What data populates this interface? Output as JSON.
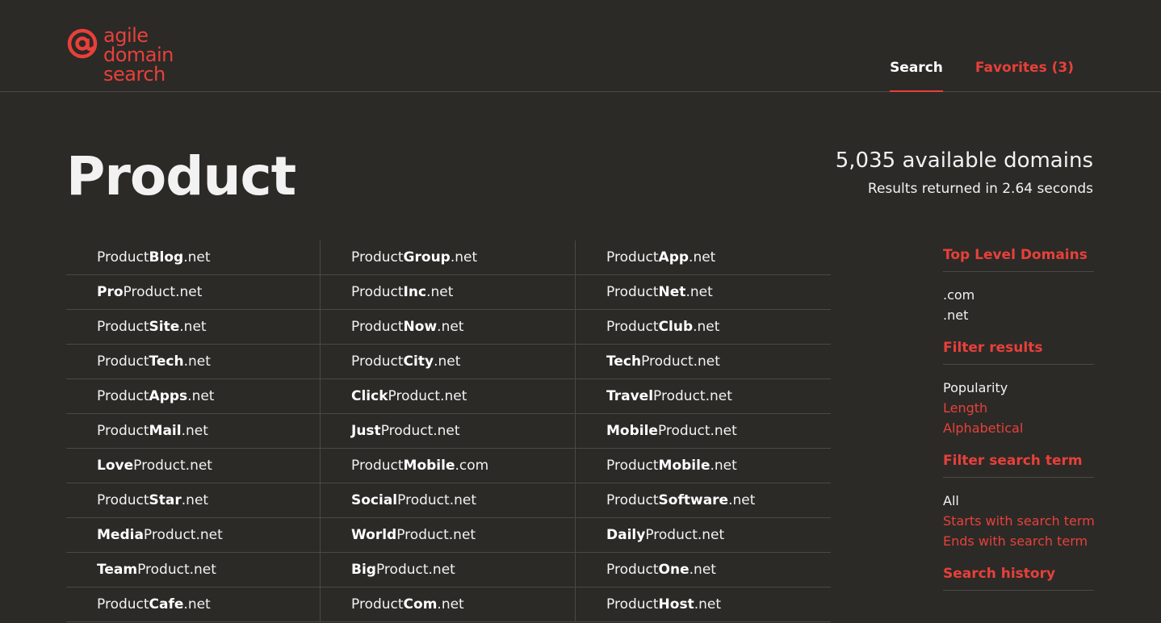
{
  "brand": {
    "name_lines": [
      "agile",
      "domain",
      "search"
    ],
    "accent": "#e8403a",
    "icon": "at-sign-icon"
  },
  "nav": {
    "search": "Search",
    "favorites": "Favorites (3)"
  },
  "query": "Product",
  "summary": {
    "count": "5,035 available domains",
    "time": "Results returned in 2.64 seconds"
  },
  "results": [
    [
      [
        "Product",
        "Blog",
        ".net",
        1
      ],
      [
        "Product",
        "Group",
        ".net",
        1
      ],
      [
        "Product",
        "App",
        ".net",
        1
      ]
    ],
    [
      [
        "Pro",
        "Product",
        ".net",
        0
      ],
      [
        "Product",
        "Inc",
        ".net",
        1
      ],
      [
        "Product",
        "Net",
        ".net",
        1
      ]
    ],
    [
      [
        "Product",
        "Site",
        ".net",
        1
      ],
      [
        "Product",
        "Now",
        ".net",
        1
      ],
      [
        "Product",
        "Club",
        ".net",
        1
      ]
    ],
    [
      [
        "Product",
        "Tech",
        ".net",
        1
      ],
      [
        "Product",
        "City",
        ".net",
        1
      ],
      [
        "Tech",
        "Product",
        ".net",
        0
      ]
    ],
    [
      [
        "Product",
        "Apps",
        ".net",
        1
      ],
      [
        "Click",
        "Product",
        ".net",
        0
      ],
      [
        "Travel",
        "Product",
        ".net",
        0
      ]
    ],
    [
      [
        "Product",
        "Mail",
        ".net",
        1
      ],
      [
        "Just",
        "Product",
        ".net",
        0
      ],
      [
        "Mobile",
        "Product",
        ".net",
        0
      ]
    ],
    [
      [
        "Love",
        "Product",
        ".net",
        0
      ],
      [
        "Product",
        "Mobile",
        ".com",
        1
      ],
      [
        "Product",
        "Mobile",
        ".net",
        1
      ]
    ],
    [
      [
        "Product",
        "Star",
        ".net",
        1
      ],
      [
        "Social",
        "Product",
        ".net",
        0
      ],
      [
        "Product",
        "Software",
        ".net",
        1
      ]
    ],
    [
      [
        "Media",
        "Product",
        ".net",
        0
      ],
      [
        "World",
        "Product",
        ".net",
        0
      ],
      [
        "Daily",
        "Product",
        ".net",
        0
      ]
    ],
    [
      [
        "Team",
        "Product",
        ".net",
        0
      ],
      [
        "Big",
        "Product",
        ".net",
        0
      ],
      [
        "Product",
        "One",
        ".net",
        1
      ]
    ],
    [
      [
        "Product",
        "Cafe",
        ".net",
        1
      ],
      [
        "Product",
        "Com",
        ".net",
        1
      ],
      [
        "Product",
        "Host",
        ".net",
        1
      ]
    ]
  ],
  "sidebar": [
    {
      "heading": "Top Level Domains",
      "items": [
        [
          ".com",
          true
        ],
        [
          ".net",
          true
        ]
      ]
    },
    {
      "heading": "Filter results",
      "items": [
        [
          "Popularity",
          true
        ],
        [
          "Length",
          false
        ],
        [
          "Alphabetical",
          false
        ]
      ]
    },
    {
      "heading": "Filter search term",
      "items": [
        [
          "All",
          true
        ],
        [
          "Starts with search term",
          false
        ],
        [
          "Ends with search term",
          false
        ]
      ]
    },
    {
      "heading": "Search history",
      "items": []
    }
  ]
}
